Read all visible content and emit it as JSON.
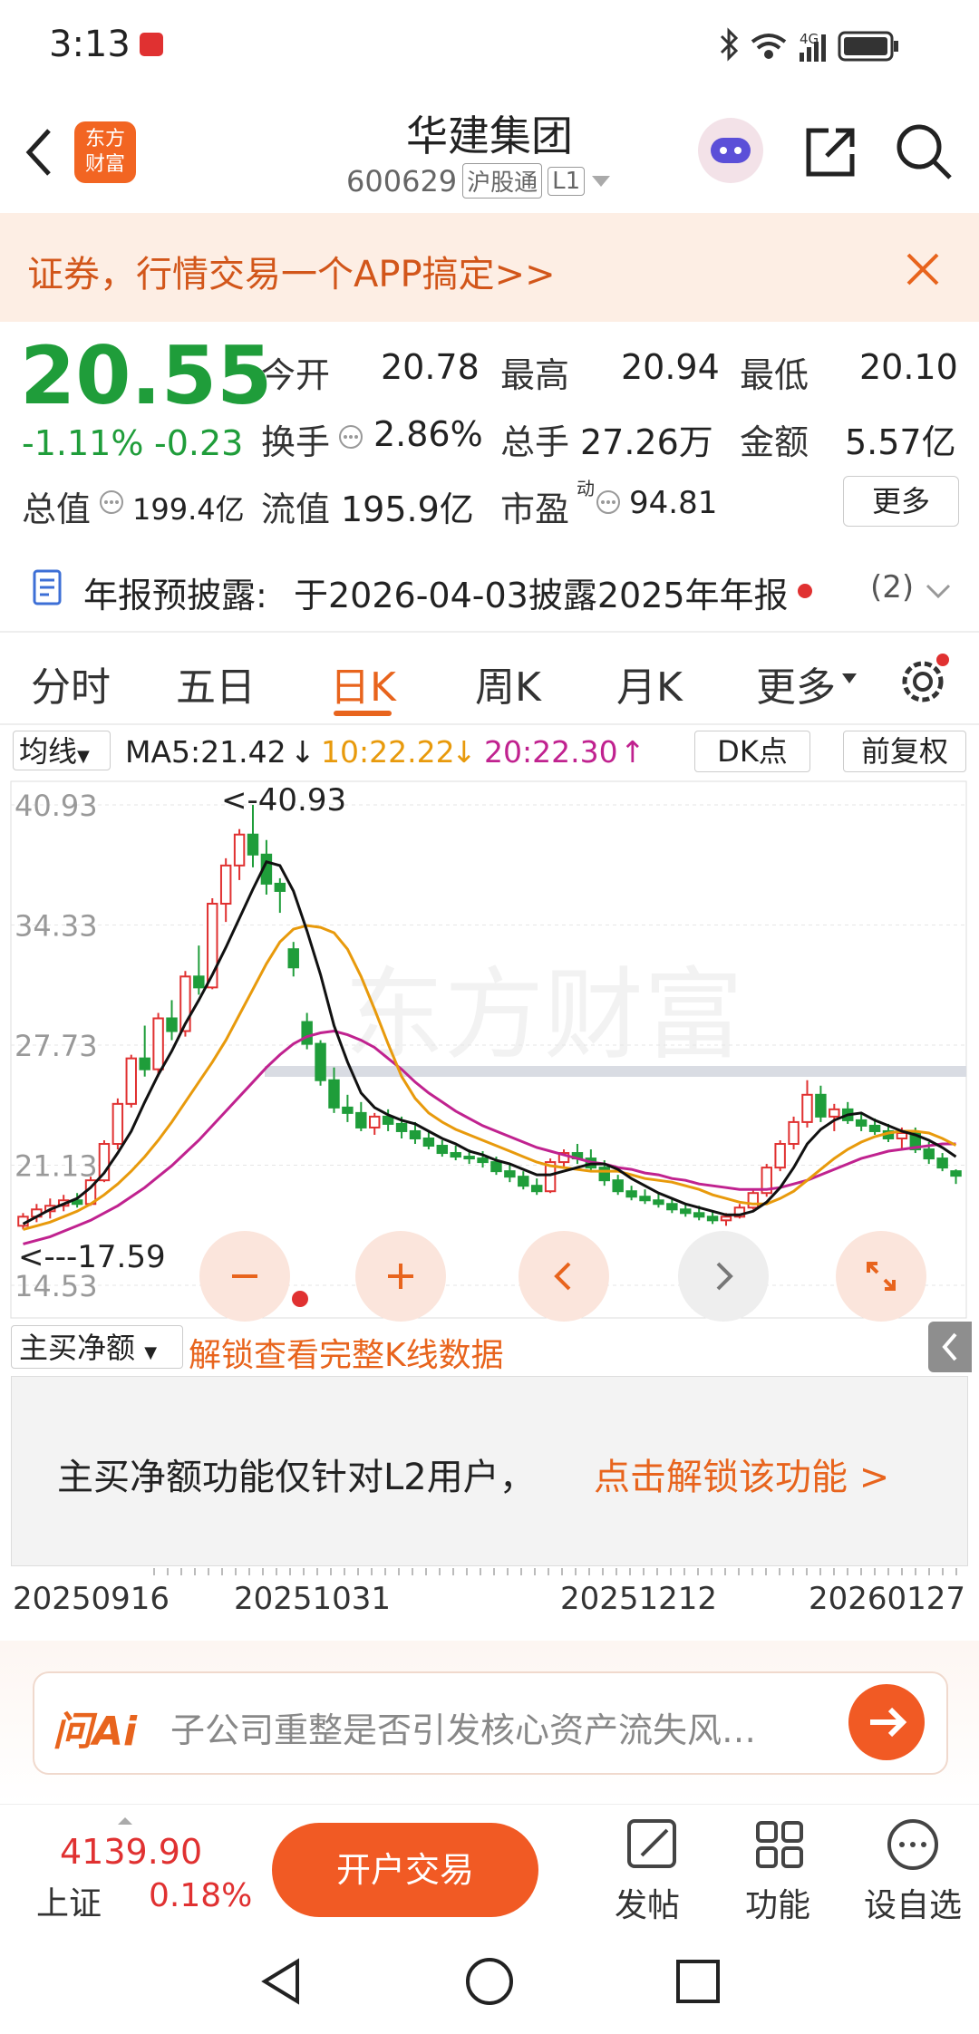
{
  "status": {
    "time": "3:13",
    "network": "4G"
  },
  "header": {
    "title": "华建集团",
    "code": "600629",
    "badge1": "沪股通",
    "badge2": "L1",
    "logo_line1": "东方",
    "logo_line2": "财富"
  },
  "banner": {
    "text": "证券，行情交易一个APP搞定>>"
  },
  "quote": {
    "price": "20.55",
    "change_pct": "-1.11%",
    "change": "-0.23",
    "open_label": "今开",
    "open": "20.78",
    "high_label": "最高",
    "high": "20.94",
    "low_label": "最低",
    "low": "20.10",
    "turnover_label": "换手",
    "turnover": "2.86%",
    "volume_label": "总手",
    "volume": "27.26万",
    "amount_label": "金额",
    "amount": "5.57亿",
    "mktcap_label": "总值",
    "mktcap": "199.4亿",
    "float_label": "流值",
    "float_cap": "195.9亿",
    "pe_label": "市盈",
    "pe_sup": "动",
    "pe": "94.81",
    "more_label": "更多"
  },
  "notice": {
    "label": "年报预披露:",
    "text": "于2026-04-03披露2025年年报",
    "count": "(2)"
  },
  "tabs": [
    "分时",
    "五日",
    "日K",
    "周K",
    "月K",
    "更多"
  ],
  "ma_bar": {
    "selector": "均线",
    "ma5": "MA5:21.42",
    "ma5_arrow": "↓",
    "ma10": "10:22.22",
    "ma10_arrow": "↓",
    "ma20": "20:22.30",
    "ma20_arrow": "↑",
    "dk": "DK点",
    "adjust": "前复权"
  },
  "chart_data": {
    "type": "candlestick",
    "y_ticks": [
      "40.93",
      "34.33",
      "27.73",
      "21.13",
      "14.53"
    ],
    "ylim": [
      14.53,
      40.93
    ],
    "annotations": {
      "max": "<-40.93",
      "min": "<---17.59"
    },
    "x_ticks": [
      "20250916",
      "20251031",
      "20251212",
      "20260127"
    ],
    "candles": [
      [
        17.8,
        18.5,
        17.6,
        18.3
      ],
      [
        18.3,
        19.0,
        18.0,
        18.7
      ],
      [
        18.6,
        19.3,
        18.2,
        18.9
      ],
      [
        18.9,
        19.5,
        18.6,
        19.2
      ],
      [
        19.2,
        19.6,
        18.8,
        19.0
      ],
      [
        19.0,
        20.5,
        18.9,
        20.3
      ],
      [
        20.3,
        22.5,
        20.2,
        22.3
      ],
      [
        22.3,
        24.8,
        22.0,
        24.5
      ],
      [
        24.5,
        27.2,
        24.3,
        27.0
      ],
      [
        27.0,
        28.8,
        26.0,
        26.4
      ],
      [
        26.4,
        29.5,
        26.0,
        29.2
      ],
      [
        29.2,
        30.2,
        28.0,
        28.5
      ],
      [
        28.5,
        31.8,
        28.2,
        31.5
      ],
      [
        31.5,
        33.2,
        30.5,
        30.9
      ],
      [
        30.9,
        35.8,
        30.8,
        35.5
      ],
      [
        35.5,
        38.0,
        34.5,
        37.6
      ],
      [
        37.6,
        39.6,
        36.8,
        39.3
      ],
      [
        39.3,
        40.93,
        37.5,
        38.2
      ],
      [
        38.2,
        39.0,
        36.0,
        36.6
      ],
      [
        36.6,
        36.9,
        35.0,
        36.2
      ],
      [
        33.0,
        33.4,
        31.5,
        32.0
      ],
      [
        29.0,
        29.5,
        27.5,
        27.8
      ],
      [
        27.8,
        28.0,
        25.5,
        25.8
      ],
      [
        25.8,
        26.5,
        24.0,
        24.3
      ],
      [
        24.3,
        25.0,
        23.5,
        24.0
      ],
      [
        24.0,
        24.6,
        23.0,
        23.2
      ],
      [
        23.2,
        24.0,
        22.8,
        23.8
      ],
      [
        23.8,
        24.2,
        23.0,
        23.4
      ],
      [
        23.4,
        23.8,
        22.6,
        23.0
      ],
      [
        23.0,
        23.5,
        22.3,
        22.6
      ],
      [
        22.6,
        23.0,
        22.0,
        22.2
      ],
      [
        22.2,
        22.5,
        21.6,
        21.8
      ],
      [
        21.8,
        22.2,
        21.4,
        21.6
      ],
      [
        21.6,
        22.0,
        21.2,
        21.5
      ],
      [
        21.5,
        21.9,
        21.0,
        21.3
      ],
      [
        21.3,
        21.6,
        20.6,
        20.8
      ],
      [
        20.8,
        21.2,
        20.2,
        20.5
      ],
      [
        20.5,
        20.8,
        19.8,
        20.0
      ],
      [
        20.0,
        20.4,
        19.5,
        19.7
      ],
      [
        19.7,
        21.5,
        19.6,
        21.3
      ],
      [
        21.3,
        22.0,
        21.0,
        21.8
      ],
      [
        21.8,
        22.3,
        21.2,
        21.5
      ],
      [
        21.5,
        22.0,
        20.8,
        21.0
      ],
      [
        21.0,
        21.4,
        20.0,
        20.3
      ],
      [
        20.3,
        20.6,
        19.5,
        19.7
      ],
      [
        19.7,
        20.0,
        19.2,
        19.4
      ],
      [
        19.4,
        19.8,
        19.0,
        19.2
      ],
      [
        19.2,
        19.6,
        18.8,
        19.0
      ],
      [
        19.0,
        19.3,
        18.5,
        18.7
      ],
      [
        18.7,
        19.0,
        18.3,
        18.5
      ],
      [
        18.5,
        18.9,
        18.1,
        18.3
      ],
      [
        18.3,
        18.6,
        17.9,
        18.1
      ],
      [
        18.1,
        18.5,
        17.8,
        18.3
      ],
      [
        18.3,
        19.0,
        18.2,
        18.8
      ],
      [
        18.8,
        19.8,
        18.7,
        19.6
      ],
      [
        19.6,
        21.2,
        19.4,
        21.0
      ],
      [
        21.0,
        22.5,
        20.8,
        22.3
      ],
      [
        22.3,
        23.8,
        22.0,
        23.5
      ],
      [
        23.5,
        25.8,
        23.2,
        25.0
      ],
      [
        25.0,
        25.5,
        23.5,
        23.8
      ],
      [
        23.8,
        24.5,
        23.0,
        24.2
      ],
      [
        24.2,
        24.6,
        23.4,
        23.6
      ],
      [
        23.6,
        24.0,
        23.0,
        23.3
      ],
      [
        23.3,
        23.7,
        22.8,
        23.0
      ],
      [
        23.0,
        23.4,
        22.4,
        22.6
      ],
      [
        22.6,
        23.2,
        22.0,
        22.9
      ],
      [
        22.9,
        23.2,
        21.8,
        22.0
      ],
      [
        22.0,
        22.4,
        21.2,
        21.5
      ],
      [
        21.5,
        21.8,
        20.8,
        21.0
      ],
      [
        20.8,
        20.9,
        20.1,
        20.55
      ]
    ],
    "ma5": [
      17.9,
      18.3,
      18.7,
      19.0,
      19.3,
      19.9,
      20.7,
      21.8,
      23.0,
      24.6,
      26.1,
      27.4,
      28.9,
      30.2,
      31.6,
      33.1,
      34.7,
      36.3,
      37.8,
      37.6,
      36.2,
      34.0,
      31.6,
      28.8,
      26.8,
      25.1,
      24.3,
      23.9,
      23.6,
      23.4,
      23.0,
      22.6,
      22.3,
      21.9,
      21.7,
      21.4,
      21.2,
      20.9,
      20.6,
      20.6,
      20.8,
      21.0,
      21.2,
      21.2,
      20.9,
      20.4,
      20.0,
      19.6,
      19.3,
      19.0,
      18.8,
      18.6,
      18.4,
      18.4,
      18.6,
      19.1,
      19.9,
      21.0,
      22.3,
      23.1,
      23.6,
      23.9,
      24.0,
      23.6,
      23.3,
      23.0,
      22.8,
      22.5,
      22.1,
      21.6
    ],
    "ma10": [
      17.6,
      17.8,
      18.0,
      18.3,
      18.6,
      19.0,
      19.5,
      20.1,
      20.8,
      21.6,
      22.5,
      23.5,
      24.6,
      25.7,
      26.8,
      28.0,
      29.4,
      30.8,
      32.2,
      33.4,
      34.1,
      34.3,
      34.2,
      33.9,
      33.0,
      31.5,
      29.7,
      27.8,
      26.0,
      24.8,
      24.0,
      23.5,
      23.1,
      22.8,
      22.5,
      22.2,
      21.9,
      21.6,
      21.3,
      21.1,
      21.0,
      20.9,
      20.8,
      20.8,
      20.8,
      20.6,
      20.4,
      20.3,
      20.2,
      20.0,
      19.8,
      19.5,
      19.3,
      19.1,
      19.0,
      19.0,
      19.3,
      19.7,
      20.3,
      20.9,
      21.5,
      22.0,
      22.4,
      22.7,
      22.9,
      23.0,
      23.0,
      22.9,
      22.6,
      22.22
    ],
    "ma20": [
      16.8,
      17.0,
      17.2,
      17.5,
      17.8,
      18.1,
      18.5,
      18.9,
      19.4,
      19.9,
      20.5,
      21.1,
      21.8,
      22.5,
      23.3,
      24.1,
      24.9,
      25.7,
      26.5,
      27.2,
      27.8,
      28.2,
      28.4,
      28.5,
      28.3,
      28.0,
      27.6,
      27.0,
      26.4,
      25.7,
      25.1,
      24.6,
      24.1,
      23.7,
      23.3,
      23.0,
      22.7,
      22.4,
      22.1,
      21.9,
      21.7,
      21.5,
      21.3,
      21.2,
      21.0,
      20.9,
      20.7,
      20.6,
      20.4,
      20.3,
      20.1,
      20.0,
      19.9,
      19.8,
      19.8,
      19.8,
      19.9,
      20.1,
      20.3,
      20.6,
      20.9,
      21.2,
      21.5,
      21.7,
      21.9,
      22.0,
      22.1,
      22.2,
      22.3,
      22.3
    ]
  },
  "sub_panel": {
    "selector": "主买净额",
    "unlock": "解锁查看完整K线数据",
    "msg": "主买净额功能仅针对L2用户，",
    "msg_link": "点击解锁该功能 >"
  },
  "ask": {
    "logo": "问Ai",
    "placeholder": "子公司重整是否引发核心资产流失风…"
  },
  "bottom": {
    "index_value": "4139.90",
    "index_name": "上证",
    "index_pct": "0.18%",
    "trade": "开户交易",
    "post": "发帖",
    "func": "功能",
    "watch": "设自选"
  },
  "watermark": "东方财富"
}
